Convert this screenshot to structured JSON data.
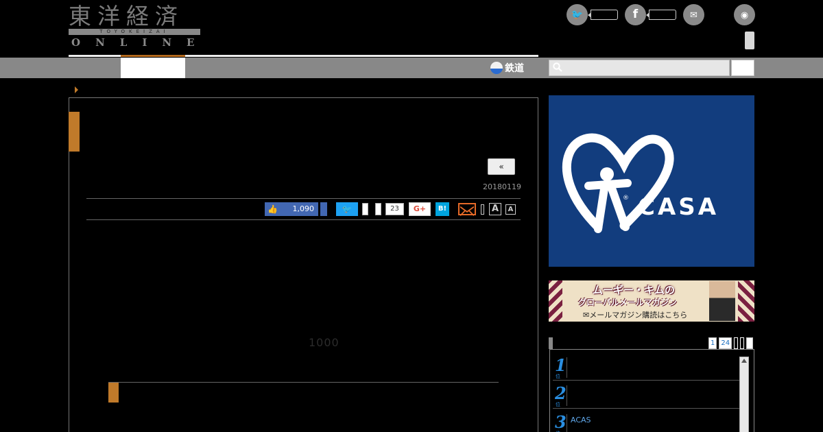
{
  "header": {
    "logo_kanji": "東洋経済",
    "logo_romaji": "TOYOKEIZAI",
    "logo_online": "ONLINE"
  },
  "social": [
    {
      "icon": "twitter-icon",
      "glyph": "🐦"
    },
    {
      "icon": "facebook-icon",
      "glyph": "f"
    },
    {
      "icon": "messenger-icon",
      "glyph": "✉"
    },
    {
      "icon": "rss-icon",
      "glyph": "◉"
    }
  ],
  "nav": {
    "rail_label": "鉄道",
    "search_placeholder": ""
  },
  "article": {
    "prev_label": "«",
    "date": "20180119",
    "fb_count": "1,090",
    "hatena_count": "23",
    "gplus_label": "G+",
    "hatena_label": "B!",
    "font_large": "A",
    "font_small": "A",
    "p1_text": "1000",
    "section_heading": ""
  },
  "sidebar": {
    "casa_text": "CASA",
    "kim_title": "ムーギー・キムの",
    "kim_sub": "グローバルメールマガジン",
    "kim_link": "✉メールマガジン購読はこちら",
    "rank_tabs": [
      "1",
      "24",
      "",
      "",
      ""
    ],
    "ranking": [
      {
        "num": "1",
        "unit": "位",
        "title": ""
      },
      {
        "num": "2",
        "unit": "位",
        "title": ""
      },
      {
        "num": "3",
        "unit": "位",
        "title": "ACAS"
      }
    ]
  },
  "colors": {
    "accent": "#c07a2a",
    "navbar": "#888888",
    "facebook": "#4267b2",
    "twitter": "#1da1f2",
    "casa_bg": "#123d7e"
  }
}
